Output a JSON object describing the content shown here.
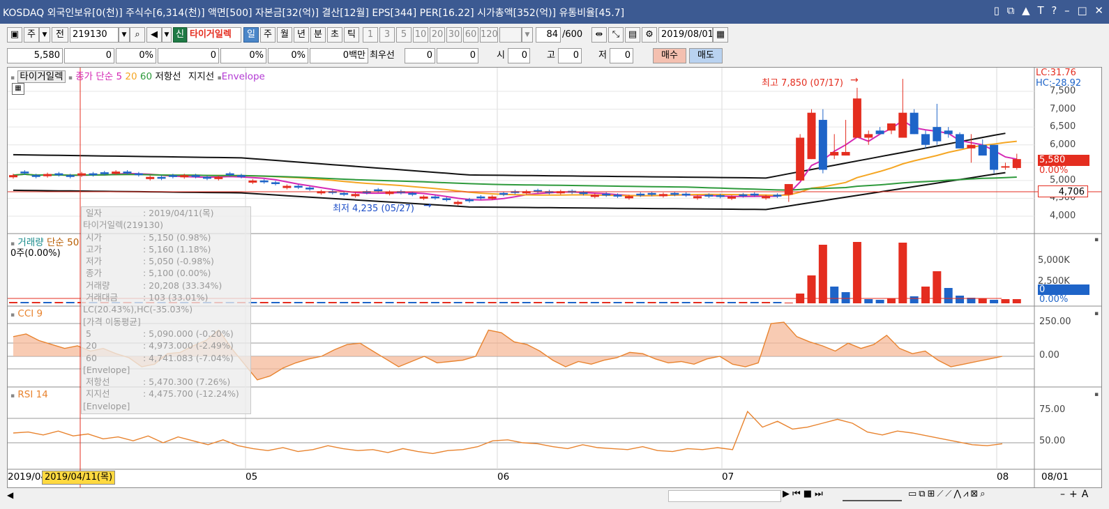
{
  "title_bar": {
    "text": "KOSDAQ 외국인보유[0(천)] 주식수[6,314(천)] 액면[500] 자본금[32(억)] 결산[12월] EPS[344] PER[16.22] 시가총액[352(억)] 유통비율[45.7]",
    "controls": [
      "▯",
      "⧉",
      "▲",
      "T",
      "?",
      "–",
      "□",
      "✕"
    ]
  },
  "toolbar": {
    "stock_label": "주",
    "prefix": "전",
    "stock_code": "219130",
    "new_badge": "신",
    "stock_name": "타이거일렉",
    "periods": [
      "일",
      "주",
      "월",
      "년",
      "분",
      "초",
      "틱"
    ],
    "active_period": "일",
    "intervals": [
      "1",
      "3",
      "5",
      "10",
      "20",
      "30",
      "60",
      "120"
    ],
    "count": "84",
    "count_total": "/600",
    "date": "2019/08/01"
  },
  "quote": {
    "price": "5,580",
    "change": "0",
    "change_pct": "0%",
    "volume": "0",
    "vol_pct": "0%",
    "pct2": "0%",
    "amount": "0백만",
    "best_label": "최우선",
    "best1": "0",
    "best2": "0",
    "open_label": "시",
    "open": "0",
    "high_label": "고",
    "high": "0",
    "low_label": "저",
    "low": "0",
    "buy": "매수",
    "sell": "매도"
  },
  "colors": {
    "up": "#e42d1f",
    "down": "#1e64c8",
    "ma5": "#d428b4",
    "ma20": "#f5a623",
    "ma60": "#2e9a3c",
    "envelope": "#111111",
    "cci_line": "#e8832e",
    "cci_pos_fill": "#f5b99a",
    "cci_neg_fill": "#9fd5ee",
    "rsi_line": "#e8832e"
  },
  "price_panel": {
    "title": "타이거일렉",
    "legend_ma": "종가 단순 5",
    "legend_20": "20",
    "legend_60": "60",
    "legend_res": "저항선",
    "legend_sup": "지지선",
    "legend_env": "Envelope",
    "high_note": "최고 7,850 (07/17)",
    "low_note": "최저 4,235 (05/27)",
    "lc": "LC:31.76",
    "hc": "HC:-28.92",
    "y_ticks": [
      "7,500",
      "7,000",
      "6,500",
      "6,000",
      "5,500",
      "5,000",
      "4,500",
      "4,000"
    ],
    "current_price": "5,580",
    "current_pct": "0.00%",
    "ref_price": "4,706"
  },
  "volume_panel": {
    "title": "거래량",
    "sub": "단순",
    "period": "50",
    "note": "0주(0.00%)",
    "y_ticks": [
      "5,000K",
      "2,500K",
      "0.00%"
    ],
    "current": "0"
  },
  "cci_panel": {
    "title": "CCI 9",
    "y_ticks": [
      "250.00",
      "0.00"
    ]
  },
  "rsi_panel": {
    "title": "RSI 14",
    "y_ticks": [
      "75.00",
      "50.00"
    ]
  },
  "x_axis": {
    "labels": [
      "2019/04",
      "05",
      "06",
      "07",
      "08",
      "08/01"
    ],
    "cursor_date": "2019/04/11(목)"
  },
  "tooltip": {
    "rows": [
      {
        "k": "일자",
        "v": ": 2019/04/11(목)"
      },
      {
        "k": "",
        "v": "타이거일렉(219130)"
      },
      {
        "k": "시가",
        "v": ": 5,150 (0.98%)"
      },
      {
        "k": "고가",
        "v": ": 5,160 (1.18%)"
      },
      {
        "k": "저가",
        "v": ": 5,050 (-0.98%)"
      },
      {
        "k": "종가",
        "v": ": 5,100 (0.00%)"
      },
      {
        "k": "거래량",
        "v": ": 20,208 (33.34%)"
      },
      {
        "k": "거래대금",
        "v": ": 103 (33.01%)"
      },
      {
        "k": "",
        "v": "LC(20.43%),HC(-35.03%)"
      },
      {
        "k": "",
        "v": "[가격 이동평균]"
      },
      {
        "k": "5",
        "v": ": 5,090.000 (-0.20%)"
      },
      {
        "k": "20",
        "v": ": 4,973.000 (-2.49%)"
      },
      {
        "k": "60",
        "v": ": 4,741.083 (-7.04%)"
      },
      {
        "k": "",
        "v": "[Envelope]"
      },
      {
        "k": "저항선",
        "v": ": 5,470.300 (7.26%)"
      },
      {
        "k": "지지선",
        "v": ": 4,475.700 (-12.24%)"
      },
      {
        "k": "",
        "v": "[Envelope]"
      }
    ]
  },
  "chart_data": {
    "type": "candlestick",
    "y_range": [
      3800,
      7800
    ],
    "sample_candles_jul": [
      {
        "o": 4600,
        "h": 4900,
        "l": 4400,
        "c": 4900
      },
      {
        "o": 5000,
        "h": 6300,
        "l": 5000,
        "c": 6200
      },
      {
        "o": 5600,
        "h": 7000,
        "l": 5600,
        "c": 6900
      },
      {
        "o": 6700,
        "h": 7000,
        "l": 5200,
        "c": 5300
      },
      {
        "o": 5700,
        "h": 6300,
        "l": 5600,
        "c": 5800
      },
      {
        "o": 5700,
        "h": 6700,
        "l": 5700,
        "c": 5800
      },
      {
        "o": 6200,
        "h": 7600,
        "l": 6200,
        "c": 7300
      },
      {
        "o": 6200,
        "h": 6400,
        "l": 6000,
        "c": 6300
      },
      {
        "o": 6400,
        "h": 6500,
        "l": 6300,
        "c": 6300
      },
      {
        "o": 6400,
        "h": 6600,
        "l": 6300,
        "c": 6600
      },
      {
        "o": 6200,
        "h": 7850,
        "l": 6200,
        "c": 6900
      },
      {
        "o": 6900,
        "h": 7000,
        "l": 6300,
        "c": 6300
      },
      {
        "o": 6300,
        "h": 6400,
        "l": 5900,
        "c": 6000
      },
      {
        "o": 6500,
        "h": 7150,
        "l": 6000,
        "c": 6100
      },
      {
        "o": 6400,
        "h": 6500,
        "l": 6200,
        "c": 6300
      },
      {
        "o": 6300,
        "h": 6350,
        "l": 5900,
        "c": 5900
      },
      {
        "o": 5900,
        "h": 6300,
        "l": 5500,
        "c": 6000
      },
      {
        "o": 6000,
        "h": 6150,
        "l": 5700,
        "c": 5700
      },
      {
        "o": 6000,
        "h": 6000,
        "l": 5200,
        "c": 5300
      },
      {
        "o": 5400,
        "h": 5500,
        "l": 5300,
        "c": 5400
      },
      {
        "o": 5350,
        "h": 5750,
        "l": 5300,
        "c": 5600
      }
    ]
  }
}
